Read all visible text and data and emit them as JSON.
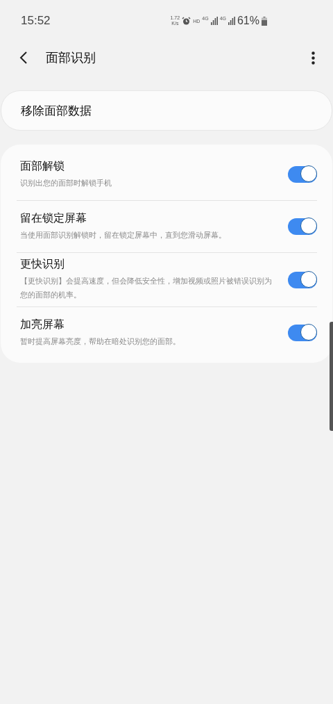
{
  "status_bar": {
    "time": "15:52",
    "speed_value": "1.72",
    "speed_unit": "K/s",
    "hd": "HD",
    "network_1": "4G",
    "network_2": "4G",
    "battery": "61%"
  },
  "app_bar": {
    "title": "面部识别"
  },
  "remove_item": {
    "label": "移除面部数据"
  },
  "settings": [
    {
      "title": "面部解锁",
      "description": "识别出您的面部时解锁手机",
      "on": true
    },
    {
      "title": "留在锁定屏幕",
      "description": "当使用面部识别解锁时，留在锁定屏幕中，直到您滑动屏幕。",
      "on": true
    },
    {
      "title": "更快识别",
      "description": "【更快识别】会提高速度，但会降低安全性，增加视频或照片被错误识别为您的面部的机率。",
      "on": true
    },
    {
      "title": "加亮屏幕",
      "description": "暂时提高屏幕亮度，帮助在暗处识别您的面部。",
      "on": true
    }
  ]
}
